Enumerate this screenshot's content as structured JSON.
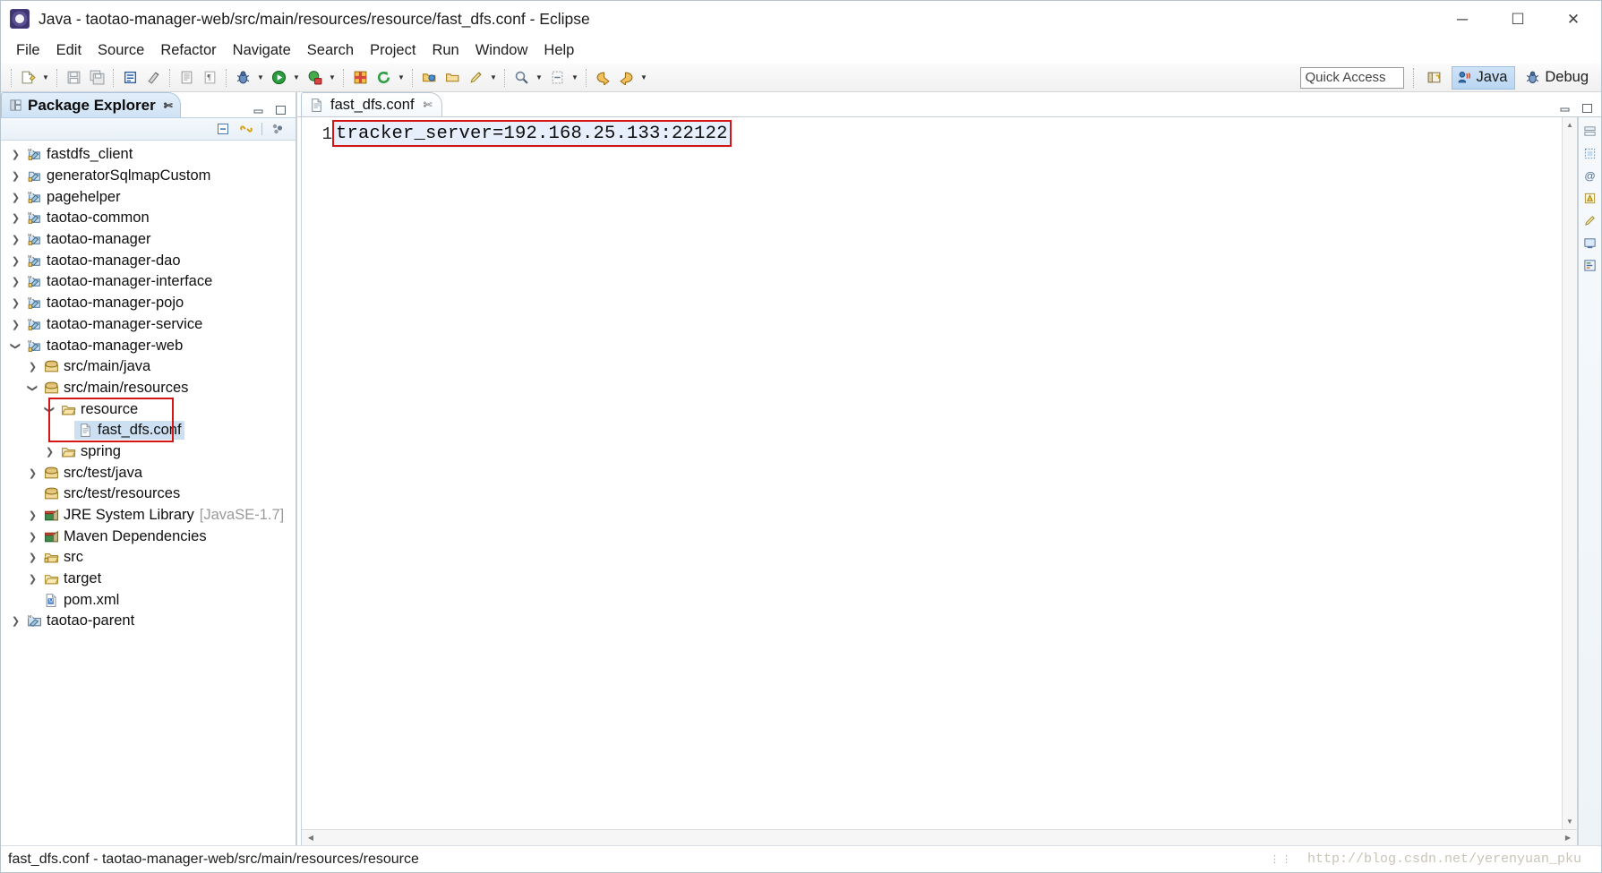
{
  "window": {
    "title": "Java - taotao-manager-web/src/main/resources/resource/fast_dfs.conf - Eclipse",
    "app_icon": "eclipse-icon",
    "minimize_label": "─",
    "maximize_label": "☐",
    "close_label": "✕"
  },
  "menubar": {
    "items": [
      {
        "label": "File"
      },
      {
        "label": "Edit"
      },
      {
        "label": "Source"
      },
      {
        "label": "Refactor"
      },
      {
        "label": "Navigate"
      },
      {
        "label": "Search"
      },
      {
        "label": "Project"
      },
      {
        "label": "Run"
      },
      {
        "label": "Window"
      },
      {
        "label": "Help"
      }
    ]
  },
  "toolbar": {
    "quick_access_placeholder": "Quick Access",
    "quick_access_value": "",
    "open_perspective_icon": "open-perspective-icon",
    "perspectives": [
      {
        "label": "Java",
        "icon": "java-perspective-icon",
        "active": true
      },
      {
        "label": "Debug",
        "icon": "debug-perspective-icon",
        "active": false
      }
    ],
    "buttons": [
      {
        "name": "new-wizard",
        "icon": "new-file-icon",
        "has_dropdown": true
      },
      {
        "name": "save",
        "icon": "save-icon",
        "has_dropdown": false
      },
      {
        "name": "save-all",
        "icon": "save-all-icon",
        "has_dropdown": false
      },
      {
        "name": "new-java-class",
        "icon": "new-class-icon",
        "has_dropdown": false
      },
      {
        "name": "new-java-package",
        "icon": "new-package-icon",
        "has_dropdown": false
      },
      {
        "name": "open-type",
        "icon": "open-type-icon",
        "has_dropdown": false
      },
      {
        "name": "toggle-mark-occurrences",
        "icon": "mark-occurrences-icon",
        "has_dropdown": false
      },
      {
        "name": "debug",
        "icon": "debug-bug-icon",
        "has_dropdown": true
      },
      {
        "name": "run",
        "icon": "run-play-icon",
        "has_dropdown": true
      },
      {
        "name": "run-external-tools",
        "icon": "external-tools-icon",
        "has_dropdown": true
      },
      {
        "name": "new-java-project",
        "icon": "new-java-project-icon",
        "has_dropdown": false
      },
      {
        "name": "refresh",
        "icon": "refresh-icon",
        "has_dropdown": true
      },
      {
        "name": "open-task",
        "icon": "open-task-icon",
        "has_dropdown": false
      },
      {
        "name": "print",
        "icon": "print-icon",
        "has_dropdown": false
      },
      {
        "name": "annotate",
        "icon": "pencil-icon",
        "has_dropdown": true
      },
      {
        "name": "search",
        "icon": "search-icon",
        "has_dropdown": true
      },
      {
        "name": "next-annotation",
        "icon": "next-annotation-icon",
        "has_dropdown": true
      },
      {
        "name": "back",
        "icon": "back-arrow-icon",
        "has_dropdown": false
      },
      {
        "name": "forward",
        "icon": "forward-arrow-icon",
        "has_dropdown": true
      }
    ]
  },
  "package_explorer": {
    "tab_label": "Package Explorer",
    "tab_icon": "package-explorer-icon",
    "tab_close_icon": "close-icon",
    "minimize_icon": "minimize-icon",
    "maximize_icon": "maximize-icon",
    "view_toolbar": [
      {
        "name": "collapse-all",
        "icon": "collapse-all-icon"
      },
      {
        "name": "link-with-editor",
        "icon": "link-with-editor-icon"
      },
      {
        "name": "view-menu",
        "icon": "view-menu-icon"
      }
    ],
    "tree": [
      {
        "label": "fastdfs_client",
        "indent": 0,
        "twisty": "collapsed",
        "icon": "maven-project-icon",
        "selected": false,
        "suffix": ""
      },
      {
        "label": "generatorSqlmapCustom",
        "indent": 0,
        "twisty": "collapsed",
        "icon": "project-icon",
        "selected": false,
        "suffix": ""
      },
      {
        "label": "pagehelper",
        "indent": 0,
        "twisty": "collapsed",
        "icon": "maven-project-icon",
        "selected": false,
        "suffix": ""
      },
      {
        "label": "taotao-common",
        "indent": 0,
        "twisty": "collapsed",
        "icon": "maven-project-icon",
        "selected": false,
        "suffix": ""
      },
      {
        "label": "taotao-manager",
        "indent": 0,
        "twisty": "collapsed",
        "icon": "maven-project-icon",
        "selected": false,
        "suffix": ""
      },
      {
        "label": "taotao-manager-dao",
        "indent": 0,
        "twisty": "collapsed",
        "icon": "maven-project-icon",
        "selected": false,
        "suffix": ""
      },
      {
        "label": "taotao-manager-interface",
        "indent": 0,
        "twisty": "collapsed",
        "icon": "maven-project-icon",
        "selected": false,
        "suffix": ""
      },
      {
        "label": "taotao-manager-pojo",
        "indent": 0,
        "twisty": "collapsed",
        "icon": "maven-project-icon",
        "selected": false,
        "suffix": ""
      },
      {
        "label": "taotao-manager-service",
        "indent": 0,
        "twisty": "collapsed",
        "icon": "maven-project-icon",
        "selected": false,
        "suffix": ""
      },
      {
        "label": "taotao-manager-web",
        "indent": 0,
        "twisty": "expanded",
        "icon": "maven-project-icon",
        "selected": false,
        "suffix": ""
      },
      {
        "label": "src/main/java",
        "indent": 1,
        "twisty": "collapsed",
        "icon": "source-folder-icon",
        "selected": false,
        "suffix": ""
      },
      {
        "label": "src/main/resources",
        "indent": 1,
        "twisty": "expanded",
        "icon": "source-folder-icon",
        "selected": false,
        "suffix": ""
      },
      {
        "label": "resource",
        "indent": 2,
        "twisty": "expanded",
        "icon": "package-folder-icon",
        "selected": false,
        "suffix": ""
      },
      {
        "label": "fast_dfs.conf",
        "indent": 3,
        "twisty": "none",
        "icon": "file-icon",
        "selected": true,
        "suffix": ""
      },
      {
        "label": "spring",
        "indent": 2,
        "twisty": "collapsed",
        "icon": "package-folder-icon",
        "selected": false,
        "suffix": ""
      },
      {
        "label": "src/test/java",
        "indent": 1,
        "twisty": "collapsed",
        "icon": "source-folder-icon",
        "selected": false,
        "suffix": ""
      },
      {
        "label": "src/test/resources",
        "indent": 1,
        "twisty": "none",
        "icon": "source-folder-icon",
        "selected": false,
        "suffix": ""
      },
      {
        "label": "JRE System Library",
        "indent": 1,
        "twisty": "collapsed",
        "icon": "library-icon",
        "selected": false,
        "suffix": "[JavaSE-1.7]"
      },
      {
        "label": "Maven Dependencies",
        "indent": 1,
        "twisty": "collapsed",
        "icon": "library-icon",
        "selected": false,
        "suffix": ""
      },
      {
        "label": "src",
        "indent": 1,
        "twisty": "collapsed",
        "icon": "folder-icon",
        "selected": false,
        "suffix": ""
      },
      {
        "label": "target",
        "indent": 1,
        "twisty": "collapsed",
        "icon": "plain-folder-icon",
        "selected": false,
        "suffix": ""
      },
      {
        "label": "pom.xml",
        "indent": 1,
        "twisty": "none",
        "icon": "pom-xml-icon",
        "selected": false,
        "suffix": ""
      },
      {
        "label": "taotao-parent",
        "indent": 0,
        "twisty": "collapsed",
        "icon": "project-folder-icon",
        "selected": false,
        "suffix": ""
      }
    ],
    "highlight": {
      "color": "#d61515",
      "target_from": "resource",
      "target_to": "fast_dfs.conf"
    }
  },
  "editor": {
    "tab_label": "fast_dfs.conf",
    "tab_icon": "file-icon",
    "tab_close_icon": "close-icon",
    "minimize_icon": "minimize-icon",
    "maximize_icon": "maximize-icon",
    "line_numbers": [
      "1"
    ],
    "lines": [
      "tracker_server=192.168.25.133:22122"
    ],
    "highlight_color": "#d61515",
    "right_ruler_icons": [
      {
        "name": "toggle-breadcrumb",
        "icon": "breadcrumb-icon"
      },
      {
        "name": "toggle-block-selection",
        "icon": "block-selection-icon"
      },
      {
        "name": "at-marker",
        "icon": "at-icon"
      },
      {
        "name": "warning-marker",
        "icon": "warning-icon"
      },
      {
        "name": "quickfix-marker",
        "icon": "quickfix-icon"
      },
      {
        "name": "display-marker",
        "icon": "display-icon"
      },
      {
        "name": "outline-marker",
        "icon": "outline-icon"
      }
    ],
    "scroll": {
      "up_arrow": "▲",
      "down_arrow": "▼",
      "left_arrow": "◀",
      "right_arrow": "▶"
    }
  },
  "statusbar": {
    "text": "fast_dfs.conf - taotao-manager-web/src/main/resources/resource",
    "watermark": "http://blog.csdn.net/yerenyuan_pku"
  }
}
